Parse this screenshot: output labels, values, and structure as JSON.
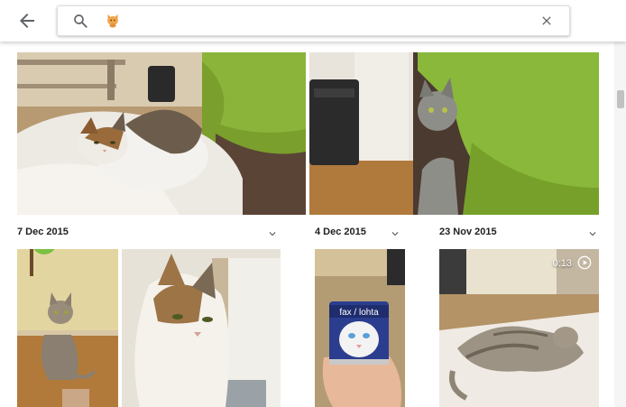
{
  "header": {
    "back_icon": "arrow-back-icon",
    "search_icon": "search-icon",
    "search_chip_icon": "cat-emoji-icon",
    "search_query": "",
    "clear_icon": "close-icon"
  },
  "sections": [
    {
      "date": "7 Dec 2015",
      "chevron_icon": "chevron-down-icon"
    },
    {
      "date": "4 Dec 2015",
      "chevron_icon": "chevron-down-icon"
    },
    {
      "date": "23 Nov 2015",
      "chevron_icon": "chevron-down-icon"
    }
  ],
  "photos": {
    "top_left": {
      "subject": "tabby-white cat on white blanket"
    },
    "top_right": {
      "subject": "gray cat peeking beside green blanket"
    },
    "row2_1": {
      "subject": "tabby cat sitting on wooden floor"
    },
    "row2_2": {
      "subject": "close-up of tabby-white cat"
    },
    "row2_3": {
      "subject": "hand holding cat food can",
      "can_label": "fax / lohta"
    },
    "row2_4": {
      "subject": "tabby cat lying on floor",
      "video_duration": "0:13",
      "play_icon": "play-circle-icon"
    }
  },
  "colors": {
    "accent_green": "#8bc34a",
    "wood_floor": "#b27a3a"
  }
}
